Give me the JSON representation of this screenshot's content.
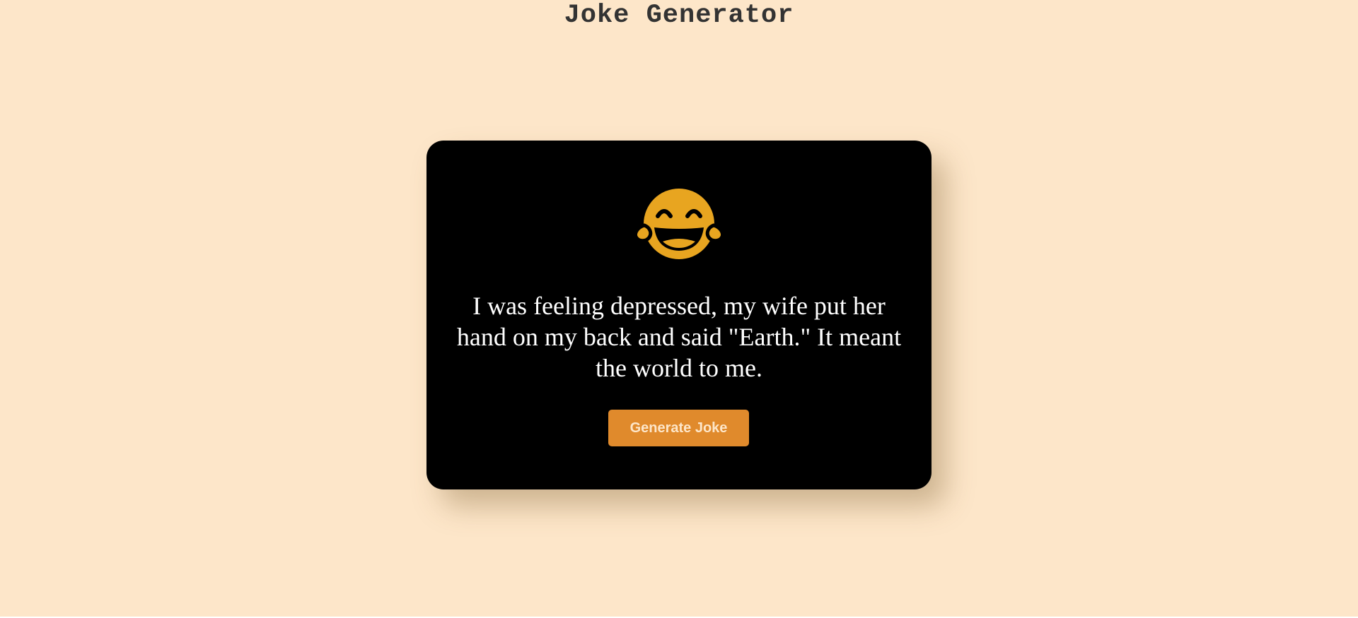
{
  "header": {
    "title": "Joke Generator"
  },
  "card": {
    "icon": "face-with-tears-of-joy-icon",
    "joke": "I was feeling depressed, my wife put her hand on my back and said \"Earth.\" It meant the world to me.",
    "button_label": "Generate Joke"
  },
  "colors": {
    "background": "#fde6c9",
    "card": "#000000",
    "emoji": "#e8a520",
    "button": "#e08a2c",
    "button_text": "#fde6c9",
    "title_text": "#333333"
  }
}
